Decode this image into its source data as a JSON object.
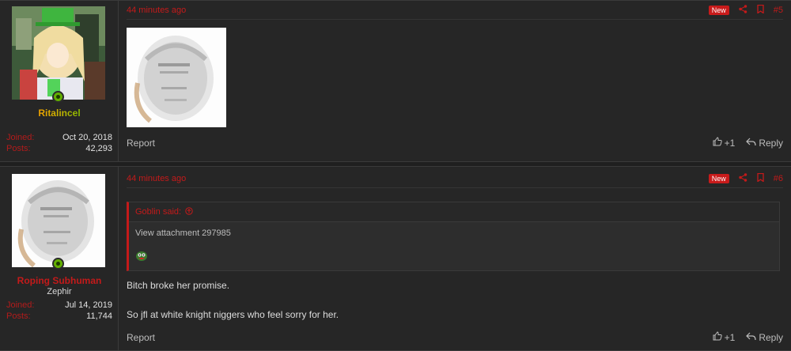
{
  "posts": [
    {
      "username": "Ritalincel",
      "user_title": "",
      "joined_label": "Joined:",
      "joined": "Oct 20, 2018",
      "posts_label": "Posts:",
      "posts": "42,293",
      "time": "44 minutes ago",
      "new_badge": "New",
      "post_number": "#5",
      "report": "Report",
      "reaction": "+1",
      "reply": "Reply"
    },
    {
      "username": "Roping Subhuman",
      "user_title": "Zephir",
      "joined_label": "Joined:",
      "joined": "Jul 14, 2019",
      "posts_label": "Posts:",
      "posts": "11,744",
      "time": "44 minutes ago",
      "new_badge": "New",
      "post_number": "#6",
      "quote_author": "Goblin said:",
      "quote_text": "View attachment 297985",
      "line1": "Bitch broke her promise.",
      "line2": "So jfl at white knight niggers who feel sorry for her.",
      "report": "Report",
      "reaction": "+1",
      "reply": "Reply"
    }
  ],
  "colors": {
    "accent": "#c41a1a",
    "online": "#63b000"
  }
}
